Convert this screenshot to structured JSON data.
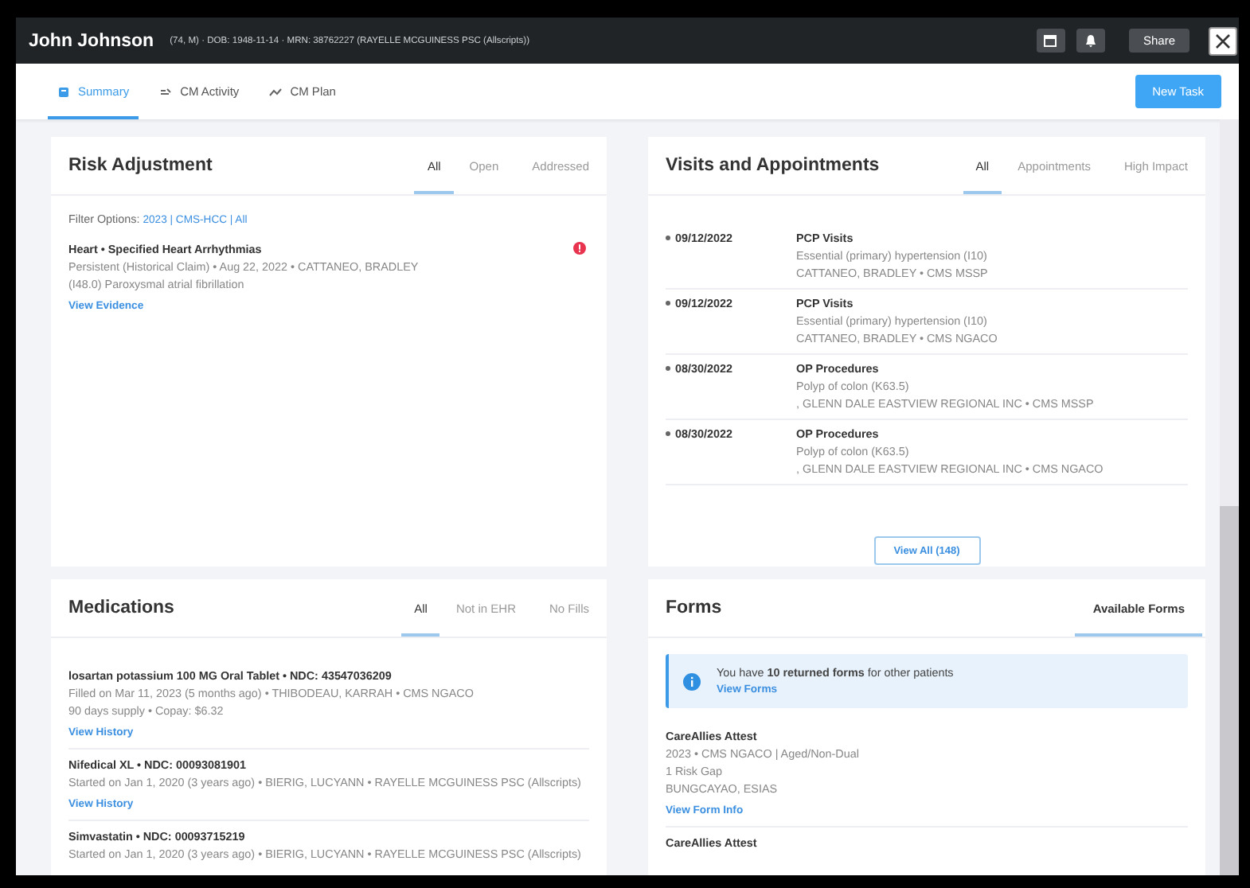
{
  "header": {
    "name": "John Johnson",
    "info": "(74, M) · DOB: 1948-11-14 · MRN: 38762227 (RAYELLE MCGUINESS PSC (Allscripts))",
    "share": "Share"
  },
  "nav": {
    "tabs": [
      {
        "label": "Summary",
        "kind": "summary",
        "selected": true
      },
      {
        "label": "CM Activity",
        "kind": "activity",
        "selected": false
      },
      {
        "label": "CM Plan",
        "kind": "plan",
        "selected": false
      }
    ],
    "action": "New Task"
  },
  "cards": [
    {
      "kind": "risk",
      "title": "Risk Adjustment",
      "tabs": [
        {
          "label": "All",
          "selected": true
        },
        {
          "label": "Open",
          "selected": false
        },
        {
          "label": "Addressed",
          "selected": false
        }
      ],
      "filter": {
        "label": "Filter Options:",
        "value": "2023 | CMS-HCC | All"
      },
      "items": [
        {
          "title": "Heart • Specified Heart Arrhythmias",
          "lines": [
            "Persistent (Historical Claim) • Aug 22, 2022 • CATTANEO, BRADLEY",
            "(I48.0) Paroxysmal atrial fibrillation"
          ],
          "link": "View Evidence",
          "flagged": true
        }
      ]
    },
    {
      "kind": "visits",
      "title": "Visits and Appointments",
      "tabs": [
        {
          "label": "All",
          "selected": true
        },
        {
          "label": "Appointments",
          "selected": false
        },
        {
          "label": "High Impact",
          "selected": false
        }
      ],
      "items": [
        {
          "date": "09/12/2022",
          "title": "PCP Visits",
          "lines": [
            "Essential (primary) hypertension (I10)",
            "CATTANEO, BRADLEY • CMS MSSP"
          ]
        },
        {
          "date": "09/12/2022",
          "title": "PCP Visits",
          "lines": [
            "Essential (primary) hypertension (I10)",
            "CATTANEO, BRADLEY • CMS NGACO"
          ]
        },
        {
          "date": "08/30/2022",
          "title": "OP Procedures",
          "lines": [
            "Polyp of colon (K63.5)",
            ", GLENN DALE EASTVIEW REGIONAL INC • CMS MSSP"
          ]
        },
        {
          "date": "08/30/2022",
          "title": "OP Procedures",
          "lines": [
            "Polyp of colon (K63.5)",
            ", GLENN DALE EASTVIEW REGIONAL INC • CMS NGACO"
          ]
        }
      ],
      "button": "View All (148)"
    },
    {
      "kind": "medications",
      "title": "Medications",
      "tabs": [
        {
          "label": "All",
          "selected": true
        },
        {
          "label": "Not in EHR",
          "selected": false
        },
        {
          "label": "No Fills",
          "selected": false
        }
      ],
      "items": [
        {
          "title": "losartan potassium 100 MG Oral Tablet • NDC: 43547036209",
          "lines": [
            "Filled on Mar 11, 2023 (5 months ago) • THIBODEAU, KARRAH • CMS NGACO",
            "90 days supply • Copay: $6.32"
          ],
          "link": "View History"
        },
        {
          "title": "Nifedical XL • NDC: 00093081901",
          "lines": [
            "Started on Jan 1, 2020 (3 years ago) • BIERIG, LUCYANN • RAYELLE MCGUINESS PSC (Allscripts)"
          ],
          "link": "View History"
        },
        {
          "title": "Simvastatin • NDC: 00093715219",
          "lines": [
            "Started on Jan 1, 2020 (3 years ago) • BIERIG, LUCYANN • RAYELLE MCGUINESS PSC (Allscripts)"
          ]
        }
      ]
    },
    {
      "kind": "forms",
      "title": "Forms",
      "tabs": [
        {
          "label": "Available Forms",
          "selected": true
        }
      ],
      "notice": {
        "text": "You have **10 returned forms** for other patients",
        "link": "View Forms"
      },
      "items": [
        {
          "title": "CareAllies Attest",
          "lines": [
            "2023 • CMS NGACO | Aged/Non-Dual",
            "1 Risk Gap",
            "BUNGCAYAO, ESIAS"
          ],
          "link": "View Form Info"
        },
        {
          "title": "CareAllies Attest"
        }
      ]
    }
  ]
}
